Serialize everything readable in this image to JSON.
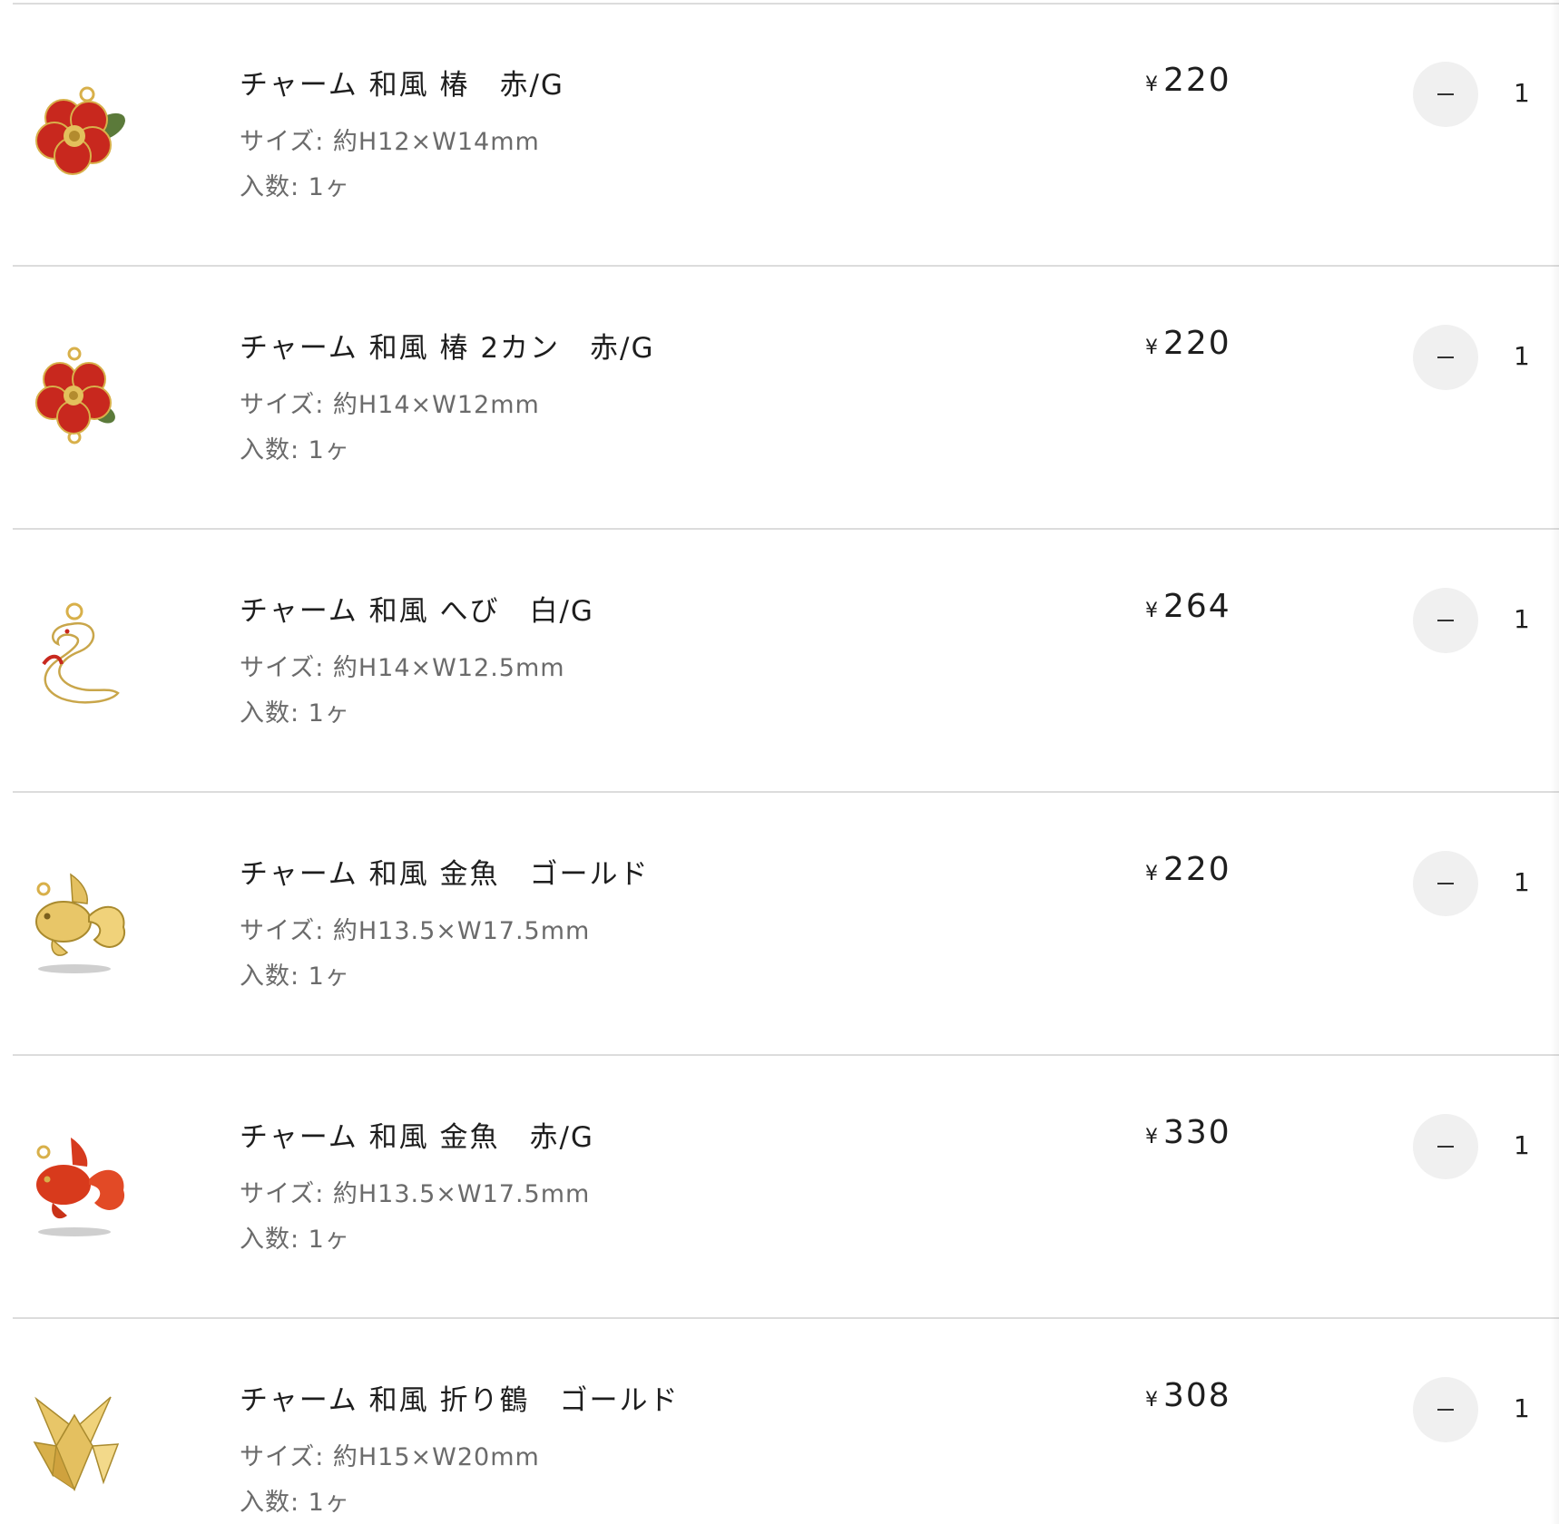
{
  "items": [
    {
      "name": "チャーム 和風 椿　赤/G",
      "size": "サイズ: 約H12×W14mm",
      "qty_label": "入数: 1ヶ",
      "currency": "¥",
      "price": "220",
      "quantity": "1",
      "icon": "camellia-charm-icon"
    },
    {
      "name": "チャーム 和風 椿 2カン　赤/G",
      "size": "サイズ: 約H14×W12mm",
      "qty_label": "入数: 1ヶ",
      "currency": "¥",
      "price": "220",
      "quantity": "1",
      "icon": "camellia-connector-charm-icon"
    },
    {
      "name": "チャーム 和風 へび　白/G",
      "size": "サイズ: 約H14×W12.5mm",
      "qty_label": "入数: 1ヶ",
      "currency": "¥",
      "price": "264",
      "quantity": "1",
      "icon": "snake-charm-icon"
    },
    {
      "name": "チャーム 和風 金魚　ゴールド",
      "size": "サイズ: 約H13.5×W17.5mm",
      "qty_label": "入数: 1ヶ",
      "currency": "¥",
      "price": "220",
      "quantity": "1",
      "icon": "goldfish-gold-charm-icon"
    },
    {
      "name": "チャーム 和風 金魚　赤/G",
      "size": "サイズ: 約H13.5×W17.5mm",
      "qty_label": "入数: 1ヶ",
      "currency": "¥",
      "price": "330",
      "quantity": "1",
      "icon": "goldfish-red-charm-icon"
    },
    {
      "name": "チャーム 和風 折り鶴　ゴールド",
      "size": "サイズ: 約H15×W20mm",
      "qty_label": "入数: 1ヶ",
      "currency": "¥",
      "price": "308",
      "quantity": "1",
      "icon": "origami-crane-charm-icon"
    }
  ],
  "minus_symbol": "−",
  "colors": {
    "divider": "#dcdcdc",
    "button_bg": "#f0f0f0",
    "text": "#1e1e1e",
    "muted_text": "#6b6b6b",
    "charm_gold": "#d8b04a",
    "charm_red": "#c8281e",
    "charm_white": "#ffffff"
  }
}
